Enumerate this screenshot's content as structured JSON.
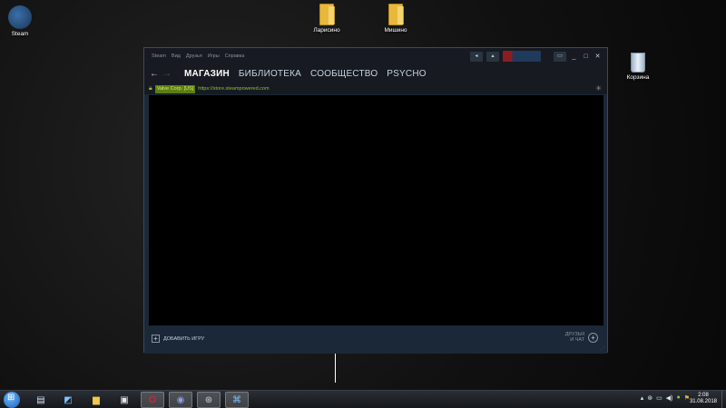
{
  "desktop": {
    "icons": [
      {
        "label": "Steam"
      },
      {
        "label": "Ларисино"
      },
      {
        "label": "Мишино"
      },
      {
        "label": "Корзина"
      }
    ]
  },
  "steam": {
    "menu": [
      "Steam",
      "Вид",
      "Друзья",
      "Игры",
      "Справка"
    ],
    "nav": {
      "tabs": [
        "МАГАЗИН",
        "БИБЛИОТЕКА",
        "СООБЩЕСТВО",
        "PSYCHO"
      ],
      "active": "МАГАЗИН"
    },
    "urlbar": {
      "cert": "Valve Corp. [US]",
      "url": "https://store.steampowered.com"
    },
    "footer": {
      "add_game": "ДОБАВИТЬ ИГРУ",
      "friends_line1": "ДРУЗЬЯ",
      "friends_line2": "И ЧАТ"
    }
  },
  "taskbar": {
    "time": "2:08",
    "date": "31.08.2018"
  },
  "colors": {
    "steam_dark": "#171a21",
    "steam_blue": "#1b2838",
    "url_green": "#8fbf3a",
    "cert_bg": "#5c7e10"
  },
  "icons": [
    "steam-icon",
    "folder-icon",
    "recycle-bin-icon",
    "back-arrow-icon",
    "forward-arrow-icon",
    "lock-icon",
    "spinner-icon",
    "plus-icon",
    "friends-chat-icon"
  ]
}
